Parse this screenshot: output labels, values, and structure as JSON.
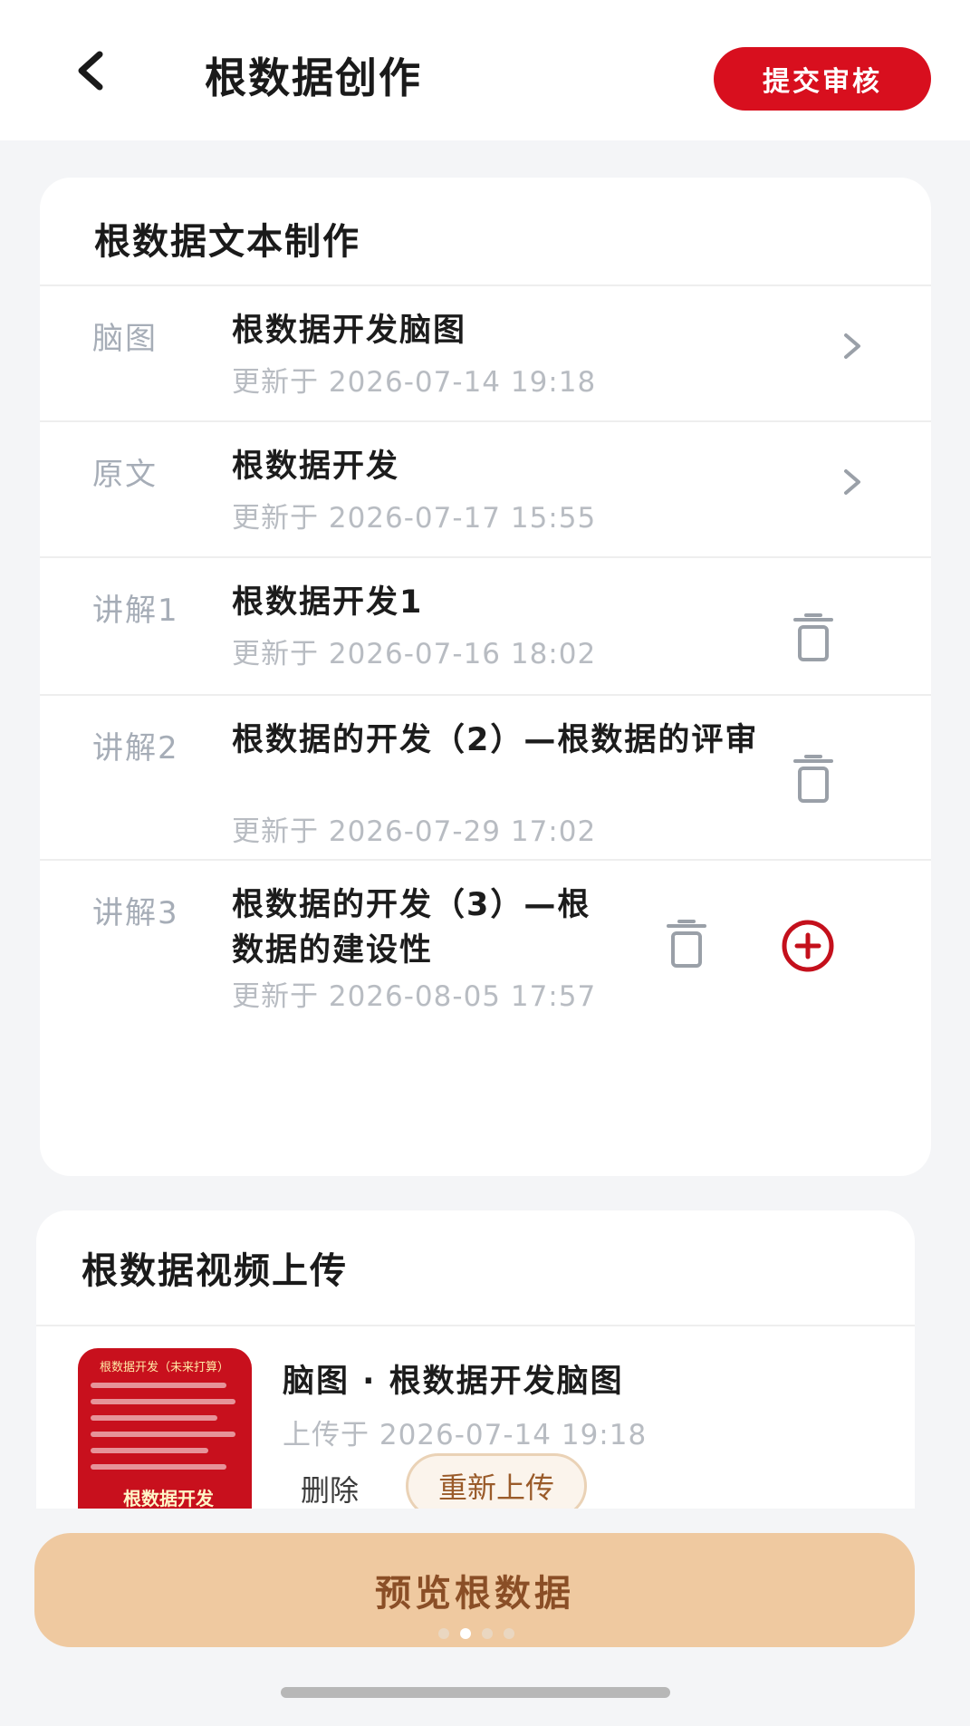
{
  "header": {
    "title": "根数据创作",
    "submit_label": "提交审核",
    "back_icon": "chevron-left-icon"
  },
  "text_section": {
    "title": "根数据文本制作",
    "rows": [
      {
        "tag": "脑图",
        "name": "根数据开发脑图",
        "time": "更新于 2026-07-14 19:18",
        "action": "chevron-right-icon"
      },
      {
        "tag": "原文",
        "name": "根数据开发",
        "time": "更新于 2026-07-17 15:55",
        "action": "chevron-right-icon"
      },
      {
        "tag": "讲解1",
        "name": "根数据开发1",
        "time": "更新于 2026-07-16 18:02",
        "action": "trash-icon"
      },
      {
        "tag": "讲解2",
        "name": "根数据的开发（2）—根数据的评审",
        "time": "更新于 2026-07-29 17:02",
        "action": "trash-icon"
      },
      {
        "tag": "讲解3",
        "name": "根数据的开发（3）—根数据的建设性",
        "time": "更新于 2026-08-05 17:57",
        "action": "trash-icon",
        "extra_action": "plus-circle-icon"
      }
    ]
  },
  "video_section": {
    "title": "根数据视频上传",
    "item": {
      "name": "脑图 · 根数据开发脑图",
      "time": "上传于 2026-07-14 19:18",
      "delete_label": "删除",
      "reupload_label": "重新上传",
      "thumbnail_title": "根数据开发",
      "thumbnail_top": "根数据开发（未来打算）"
    }
  },
  "footer": {
    "preview_label": "预览根数据",
    "page_dots": 4,
    "active_dot": 2
  },
  "colors": {
    "brand_red": "#d80f1e",
    "preview_bg": "#efc9a0",
    "preview_text": "#8a4e26"
  }
}
